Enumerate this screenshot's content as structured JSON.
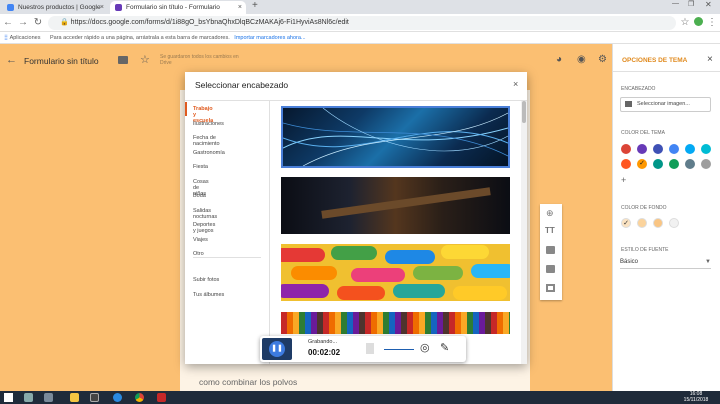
{
  "tabs": [
    {
      "label": "Nuestros productos | Google",
      "close": "×"
    },
    {
      "label": "Formulario sin título - Formulario",
      "close": "×"
    }
  ],
  "new_tab": "+",
  "omnibox": {
    "secure_label": "Es seguro",
    "url": "https://docs.google.com/forms/d/1i88gO_bsYbnaQhxDlqBCzMAKAj6-Fi1HyviAs8Nl6c/edit"
  },
  "bookmarks": {
    "apps": "Aplicaciones",
    "hint": "Para acceder rápido a una página, arrástrala a esta barra de marcadores.",
    "import": "Importar marcadores ahora..."
  },
  "form": {
    "title": "Formulario sin título",
    "saved_note": "Se guardaron todos los cambios en Drive",
    "question_text": "como combinar los polvos"
  },
  "dialog": {
    "title": "Seleccionar encabezado",
    "close": "×",
    "categories": [
      "Trabajo y escuela",
      "Ilustraciones",
      "Fecha de nacimiento",
      "Gastronomía",
      "Fiesta",
      "Cosas de niños",
      "Boda",
      "Salidas nocturnas",
      "Deportes y juegos",
      "Viajes",
      "Otro"
    ],
    "selected_category": "Trabajo y escuela",
    "extra": [
      "Subir fotos",
      "Tus álbumes"
    ]
  },
  "theme_panel": {
    "title": "OPCIONES DE TEMA",
    "close": "×",
    "header_label": "ENCABEZADO",
    "select_image": "Seleccionar imagen...",
    "theme_color_label": "COLOR DEL TEMA",
    "theme_colors": [
      "#db4437",
      "#673ab7",
      "#3f51b5",
      "#4285f4",
      "#03a9f4",
      "#00bcd4",
      "#ff5722",
      "#ff9800",
      "#009688",
      "#0f9d58",
      "#607d8b",
      "#9e9e9e"
    ],
    "selected_theme_color": "#ff9800",
    "bg_color_label": "COLOR DE FONDO",
    "bg_colors": [
      "#fbe3c2",
      "#fbd39c",
      "#f9c583",
      "#f1f1f1"
    ],
    "font_label": "ESTILO DE FUENTE",
    "font_value": "Básico"
  },
  "recorder": {
    "status": "Grabando...",
    "time": "00:02:02"
  },
  "clock": {
    "time": "16:08",
    "date": "15/11/2018"
  }
}
